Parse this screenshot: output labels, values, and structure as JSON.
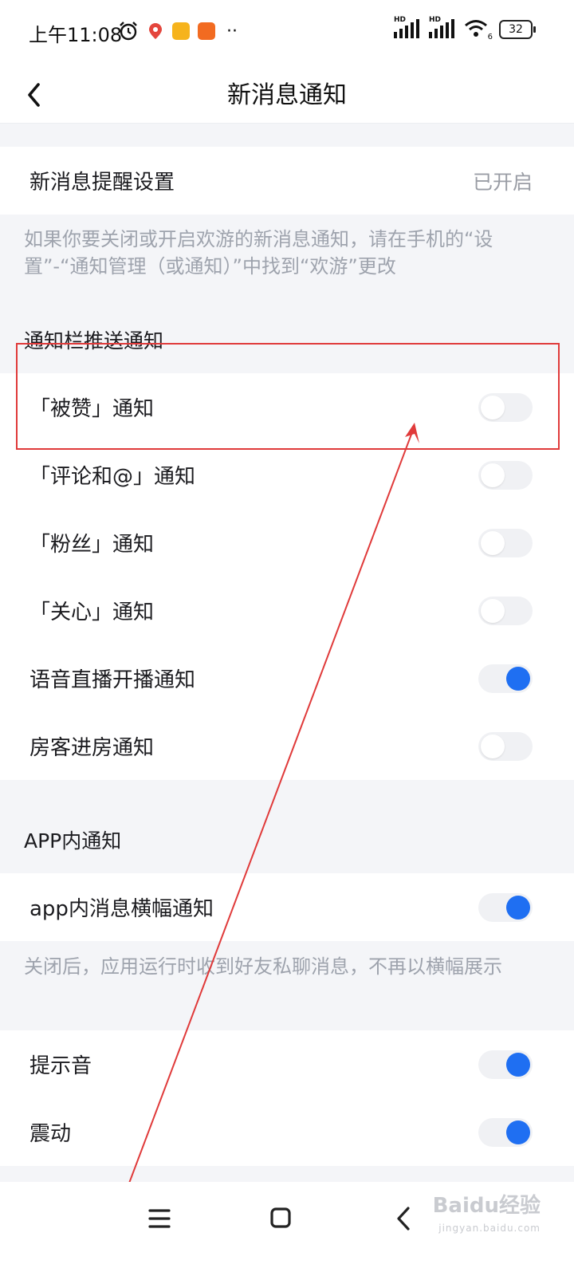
{
  "status_bar": {
    "time": "上午11:08",
    "battery": "32",
    "signal_tag_1": "HD",
    "signal_tag_2": "HD",
    "wifi_sub": "6",
    "more": "··"
  },
  "header": {
    "title": "新消息通知"
  },
  "reminder": {
    "label": "新消息提醒设置",
    "value": "已开启",
    "hint": "如果你要关闭或开启欢游的新消息通知，请在手机的“设置”-“通知管理（或通知）”中找到“欢游”更改"
  },
  "push_section": {
    "title": "通知栏推送通知",
    "items": [
      {
        "label": "「被赞」通知",
        "on": false
      },
      {
        "label": "「评论和@」通知",
        "on": false
      },
      {
        "label": "「粉丝」通知",
        "on": false
      },
      {
        "label": "「关心」通知",
        "on": false
      },
      {
        "label": "语音直播开播通知",
        "on": true
      },
      {
        "label": "房客进房通知",
        "on": false
      }
    ]
  },
  "app_section": {
    "title": "APP内通知",
    "banner": {
      "label": "app内消息横幅通知",
      "on": true
    },
    "banner_hint": "关闭后，应用运行时收到好友私聊消息，不再以横幅展示",
    "sound": {
      "label": "提示音",
      "on": true
    },
    "vibrate": {
      "label": "震动",
      "on": true
    }
  },
  "watermark": {
    "brand": "Bai",
    "brand_du": "du",
    "brand_suffix": "经验",
    "sub": "jingyan.baidu.com"
  },
  "colors": {
    "toggle_on": "#1f6ff2",
    "toggle_track": "#f0f1f4",
    "annotation": "#e03a3a"
  },
  "icons": {
    "back": "chevron-left-icon",
    "menu": "hamburger-icon",
    "home": "square-icon",
    "nav_back": "chevron-left-icon"
  }
}
